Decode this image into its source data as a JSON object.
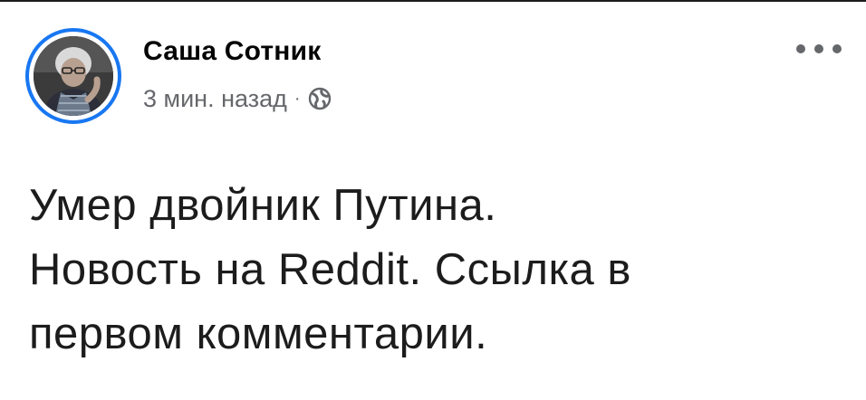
{
  "post": {
    "author": {
      "name": "Саша Сотник"
    },
    "timestamp": "3 мин. назад",
    "separator": "·",
    "privacy_icon": "globe-icon",
    "more_icon": "more-options-icon",
    "text_lines": [
      "Умер двойник Путина.",
      "Новость на Reddit. Ссылка в",
      "первом комментарии."
    ]
  },
  "colors": {
    "avatar_ring": "#1877f2",
    "secondary_text": "#65676b",
    "primary_text": "#050505"
  }
}
